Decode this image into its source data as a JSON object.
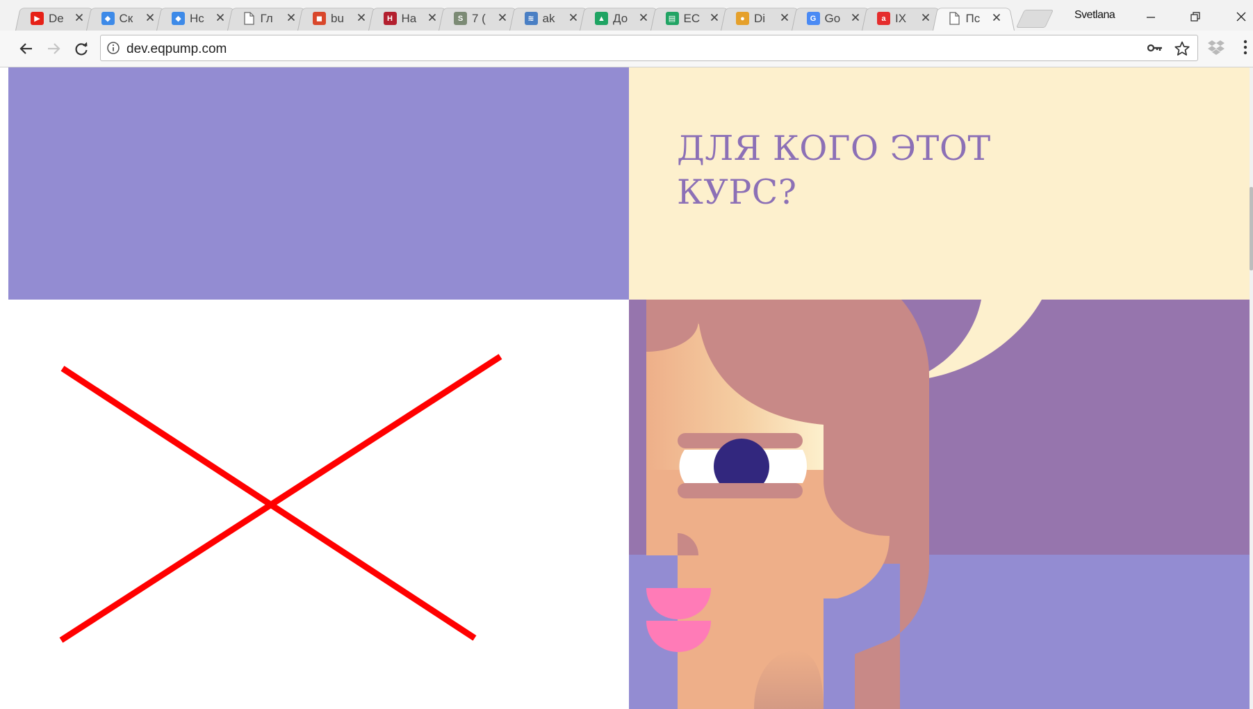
{
  "browser": {
    "tabs": [
      {
        "label": "De",
        "icon": "youtube-icon",
        "color": "#e62117",
        "active": false
      },
      {
        "label": "Ск",
        "icon": "dropbox-icon",
        "color": "#3d8ae8",
        "active": false
      },
      {
        "label": "Hc",
        "icon": "dropbox-icon",
        "color": "#3d8ae8",
        "active": false
      },
      {
        "label": "Гл",
        "icon": "document-icon",
        "color": "#666666",
        "active": false
      },
      {
        "label": "bu",
        "icon": "shield-crest-icon",
        "color": "#d9472b",
        "active": false
      },
      {
        "label": "Ha",
        "icon": "hbr-icon",
        "color": "#b31f2e",
        "active": false
      },
      {
        "label": "7 (",
        "icon": "s-letter-icon",
        "color": "#7c8b75",
        "active": false
      },
      {
        "label": "ak",
        "icon": "stripes-circle-icon",
        "color": "#4a7fc4",
        "active": false
      },
      {
        "label": "До",
        "icon": "drive-icon",
        "color": "#1fa463",
        "active": false
      },
      {
        "label": "EC",
        "icon": "sheets-icon",
        "color": "#21a464",
        "active": false
      },
      {
        "label": "Di",
        "icon": "color-wheel-icon",
        "color": "#e5a02b",
        "active": false
      },
      {
        "label": "Go",
        "icon": "google-translate-icon",
        "color": "#4a8af4",
        "active": false
      },
      {
        "label": "IX",
        "icon": "a-letter-icon",
        "color": "#e52d2d",
        "active": false
      },
      {
        "label": "Пс",
        "icon": "document-icon",
        "color": "#666666",
        "active": true
      }
    ],
    "profile_name": "Svetlana",
    "url": "dev.eqpump.com"
  },
  "page": {
    "heading": "ДЛЯ КОГО ЭТОТ КУРС?"
  },
  "colors": {
    "purple_block": "#938cd2",
    "cream_block": "#fdf0cd",
    "heading": "#8c70b6",
    "cross": "#ff0000",
    "illustration_bg": "#9675ad",
    "hair": "#c88987",
    "skin": "#eeaf89",
    "eye_pupil": "#32277e",
    "lips": "#ff7bb7"
  }
}
